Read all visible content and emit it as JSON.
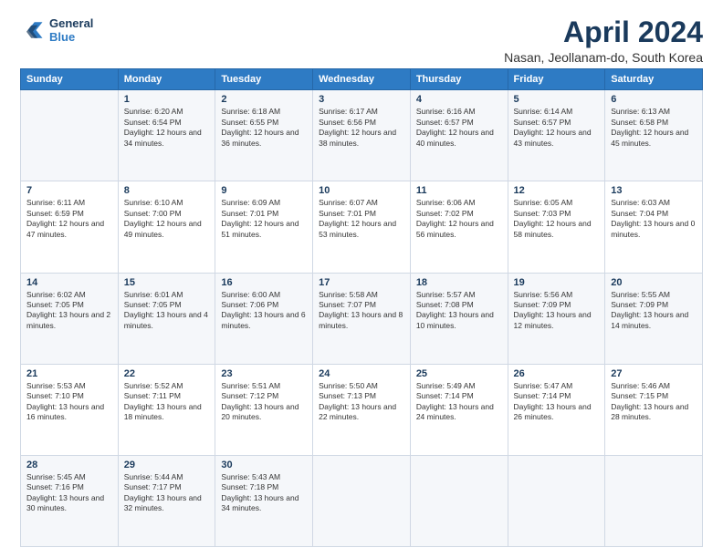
{
  "logo": {
    "line1": "General",
    "line2": "Blue"
  },
  "title": "April 2024",
  "subtitle": "Nasan, Jeollanam-do, South Korea",
  "days_header": [
    "Sunday",
    "Monday",
    "Tuesday",
    "Wednesday",
    "Thursday",
    "Friday",
    "Saturday"
  ],
  "weeks": [
    [
      {
        "day": "",
        "sunrise": "",
        "sunset": "",
        "daylight": ""
      },
      {
        "day": "1",
        "sunrise": "Sunrise: 6:20 AM",
        "sunset": "Sunset: 6:54 PM",
        "daylight": "Daylight: 12 hours and 34 minutes."
      },
      {
        "day": "2",
        "sunrise": "Sunrise: 6:18 AM",
        "sunset": "Sunset: 6:55 PM",
        "daylight": "Daylight: 12 hours and 36 minutes."
      },
      {
        "day": "3",
        "sunrise": "Sunrise: 6:17 AM",
        "sunset": "Sunset: 6:56 PM",
        "daylight": "Daylight: 12 hours and 38 minutes."
      },
      {
        "day": "4",
        "sunrise": "Sunrise: 6:16 AM",
        "sunset": "Sunset: 6:57 PM",
        "daylight": "Daylight: 12 hours and 40 minutes."
      },
      {
        "day": "5",
        "sunrise": "Sunrise: 6:14 AM",
        "sunset": "Sunset: 6:57 PM",
        "daylight": "Daylight: 12 hours and 43 minutes."
      },
      {
        "day": "6",
        "sunrise": "Sunrise: 6:13 AM",
        "sunset": "Sunset: 6:58 PM",
        "daylight": "Daylight: 12 hours and 45 minutes."
      }
    ],
    [
      {
        "day": "7",
        "sunrise": "Sunrise: 6:11 AM",
        "sunset": "Sunset: 6:59 PM",
        "daylight": "Daylight: 12 hours and 47 minutes."
      },
      {
        "day": "8",
        "sunrise": "Sunrise: 6:10 AM",
        "sunset": "Sunset: 7:00 PM",
        "daylight": "Daylight: 12 hours and 49 minutes."
      },
      {
        "day": "9",
        "sunrise": "Sunrise: 6:09 AM",
        "sunset": "Sunset: 7:01 PM",
        "daylight": "Daylight: 12 hours and 51 minutes."
      },
      {
        "day": "10",
        "sunrise": "Sunrise: 6:07 AM",
        "sunset": "Sunset: 7:01 PM",
        "daylight": "Daylight: 12 hours and 53 minutes."
      },
      {
        "day": "11",
        "sunrise": "Sunrise: 6:06 AM",
        "sunset": "Sunset: 7:02 PM",
        "daylight": "Daylight: 12 hours and 56 minutes."
      },
      {
        "day": "12",
        "sunrise": "Sunrise: 6:05 AM",
        "sunset": "Sunset: 7:03 PM",
        "daylight": "Daylight: 12 hours and 58 minutes."
      },
      {
        "day": "13",
        "sunrise": "Sunrise: 6:03 AM",
        "sunset": "Sunset: 7:04 PM",
        "daylight": "Daylight: 13 hours and 0 minutes."
      }
    ],
    [
      {
        "day": "14",
        "sunrise": "Sunrise: 6:02 AM",
        "sunset": "Sunset: 7:05 PM",
        "daylight": "Daylight: 13 hours and 2 minutes."
      },
      {
        "day": "15",
        "sunrise": "Sunrise: 6:01 AM",
        "sunset": "Sunset: 7:05 PM",
        "daylight": "Daylight: 13 hours and 4 minutes."
      },
      {
        "day": "16",
        "sunrise": "Sunrise: 6:00 AM",
        "sunset": "Sunset: 7:06 PM",
        "daylight": "Daylight: 13 hours and 6 minutes."
      },
      {
        "day": "17",
        "sunrise": "Sunrise: 5:58 AM",
        "sunset": "Sunset: 7:07 PM",
        "daylight": "Daylight: 13 hours and 8 minutes."
      },
      {
        "day": "18",
        "sunrise": "Sunrise: 5:57 AM",
        "sunset": "Sunset: 7:08 PM",
        "daylight": "Daylight: 13 hours and 10 minutes."
      },
      {
        "day": "19",
        "sunrise": "Sunrise: 5:56 AM",
        "sunset": "Sunset: 7:09 PM",
        "daylight": "Daylight: 13 hours and 12 minutes."
      },
      {
        "day": "20",
        "sunrise": "Sunrise: 5:55 AM",
        "sunset": "Sunset: 7:09 PM",
        "daylight": "Daylight: 13 hours and 14 minutes."
      }
    ],
    [
      {
        "day": "21",
        "sunrise": "Sunrise: 5:53 AM",
        "sunset": "Sunset: 7:10 PM",
        "daylight": "Daylight: 13 hours and 16 minutes."
      },
      {
        "day": "22",
        "sunrise": "Sunrise: 5:52 AM",
        "sunset": "Sunset: 7:11 PM",
        "daylight": "Daylight: 13 hours and 18 minutes."
      },
      {
        "day": "23",
        "sunrise": "Sunrise: 5:51 AM",
        "sunset": "Sunset: 7:12 PM",
        "daylight": "Daylight: 13 hours and 20 minutes."
      },
      {
        "day": "24",
        "sunrise": "Sunrise: 5:50 AM",
        "sunset": "Sunset: 7:13 PM",
        "daylight": "Daylight: 13 hours and 22 minutes."
      },
      {
        "day": "25",
        "sunrise": "Sunrise: 5:49 AM",
        "sunset": "Sunset: 7:14 PM",
        "daylight": "Daylight: 13 hours and 24 minutes."
      },
      {
        "day": "26",
        "sunrise": "Sunrise: 5:47 AM",
        "sunset": "Sunset: 7:14 PM",
        "daylight": "Daylight: 13 hours and 26 minutes."
      },
      {
        "day": "27",
        "sunrise": "Sunrise: 5:46 AM",
        "sunset": "Sunset: 7:15 PM",
        "daylight": "Daylight: 13 hours and 28 minutes."
      }
    ],
    [
      {
        "day": "28",
        "sunrise": "Sunrise: 5:45 AM",
        "sunset": "Sunset: 7:16 PM",
        "daylight": "Daylight: 13 hours and 30 minutes."
      },
      {
        "day": "29",
        "sunrise": "Sunrise: 5:44 AM",
        "sunset": "Sunset: 7:17 PM",
        "daylight": "Daylight: 13 hours and 32 minutes."
      },
      {
        "day": "30",
        "sunrise": "Sunrise: 5:43 AM",
        "sunset": "Sunset: 7:18 PM",
        "daylight": "Daylight: 13 hours and 34 minutes."
      },
      {
        "day": "",
        "sunrise": "",
        "sunset": "",
        "daylight": ""
      },
      {
        "day": "",
        "sunrise": "",
        "sunset": "",
        "daylight": ""
      },
      {
        "day": "",
        "sunrise": "",
        "sunset": "",
        "daylight": ""
      },
      {
        "day": "",
        "sunrise": "",
        "sunset": "",
        "daylight": ""
      }
    ]
  ]
}
